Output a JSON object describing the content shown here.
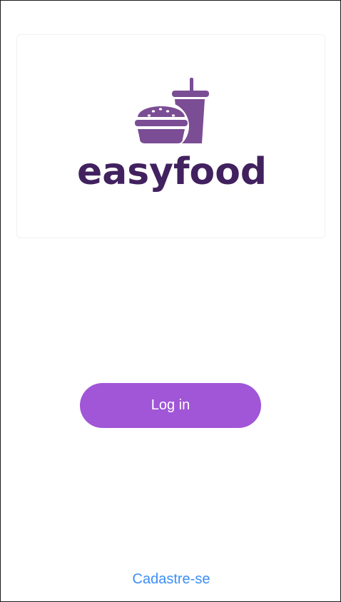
{
  "logo": {
    "icon": "burger-and-drink-icon",
    "wordmark": "easyfood",
    "colors": {
      "icon": "#7b4d94",
      "wordmark": "#42215f"
    }
  },
  "login_button": {
    "label": "Log in",
    "color": "#a056d6"
  },
  "signup_link": {
    "label": "Cadastre-se",
    "color": "#3b8ff5"
  }
}
